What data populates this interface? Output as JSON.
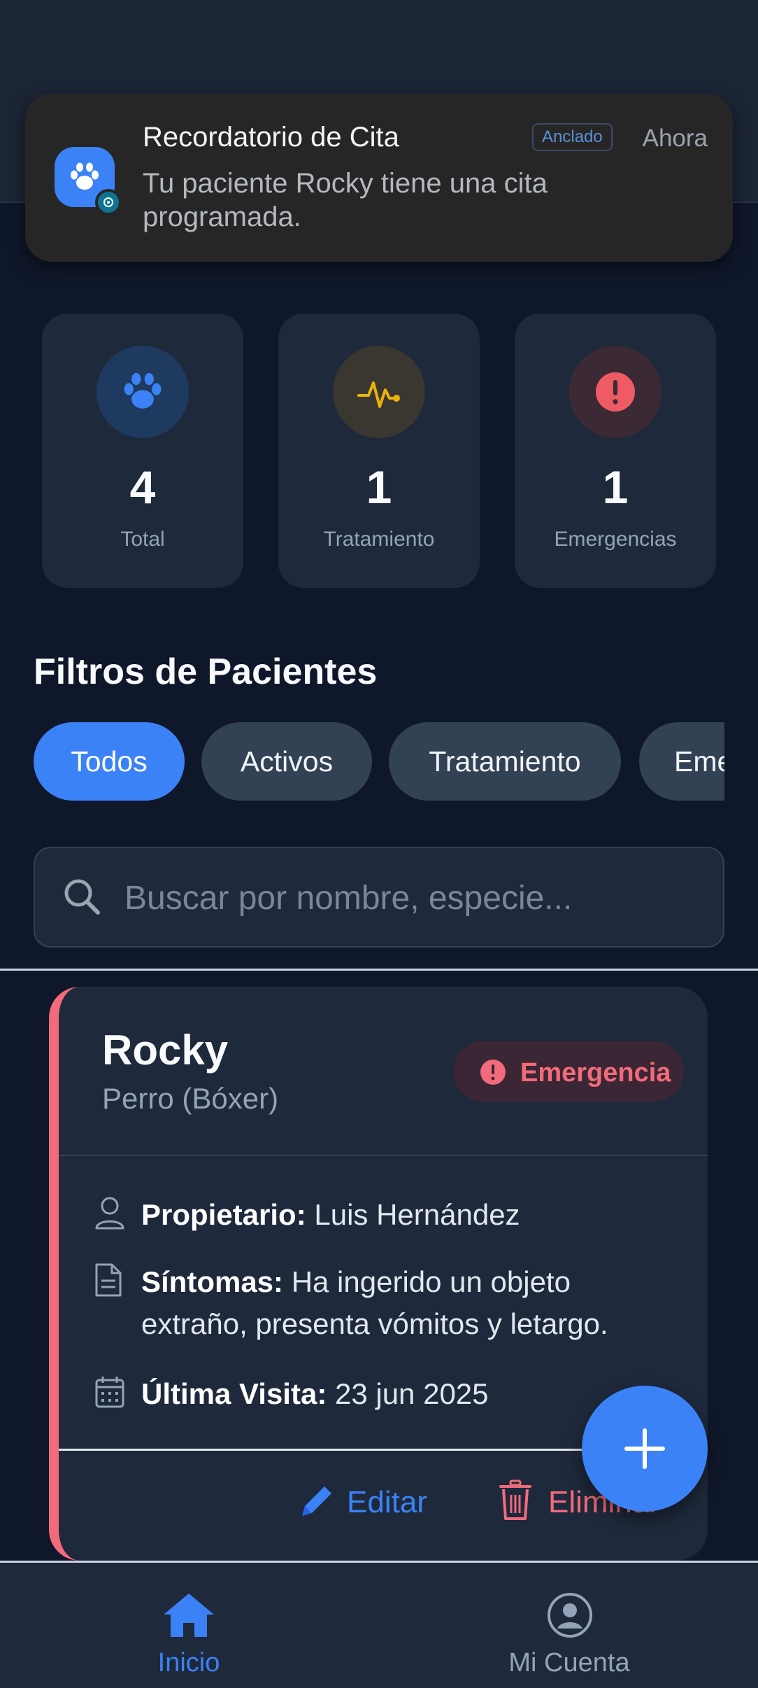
{
  "notification": {
    "title": "Recordatorio de Cita",
    "pinned_label": "Anclado",
    "time": "Ahora",
    "body": "Tu paciente Rocky tiene una cita programada."
  },
  "stats": [
    {
      "value": "4",
      "label": "Total",
      "icon": "paw-icon",
      "color": "#3b82f6"
    },
    {
      "value": "1",
      "label": "Tratamiento",
      "icon": "pulse-icon",
      "color": "#eab308"
    },
    {
      "value": "1",
      "label": "Emergencias",
      "icon": "alert-icon",
      "color": "#ef4444"
    }
  ],
  "filters": {
    "title": "Filtros de Pacientes",
    "chips": [
      "Todos",
      "Activos",
      "Tratamiento",
      "Emergencias"
    ],
    "active": "Todos"
  },
  "search": {
    "placeholder": "Buscar por nombre, especie..."
  },
  "patient": {
    "name": "Rocky",
    "species": "Perro (Bóxer)",
    "status": "Emergencia",
    "owner_label": "Propietario:",
    "owner": "Luis Hernández",
    "symptoms_label": "Síntomas:",
    "symptoms": "Ha ingerido un objeto extraño, presenta vómitos y letargo.",
    "last_visit_label": "Última Visita:",
    "last_visit": "23 jun 2025",
    "edit_label": "Editar",
    "delete_label": "Eliminar"
  },
  "nav": {
    "home_label": "Inicio",
    "account_label": "Mi Cuenta"
  },
  "colors": {
    "accent": "#3b82f6",
    "danger": "#f26b7a",
    "background": "#0f172a",
    "card": "#1e293b"
  }
}
